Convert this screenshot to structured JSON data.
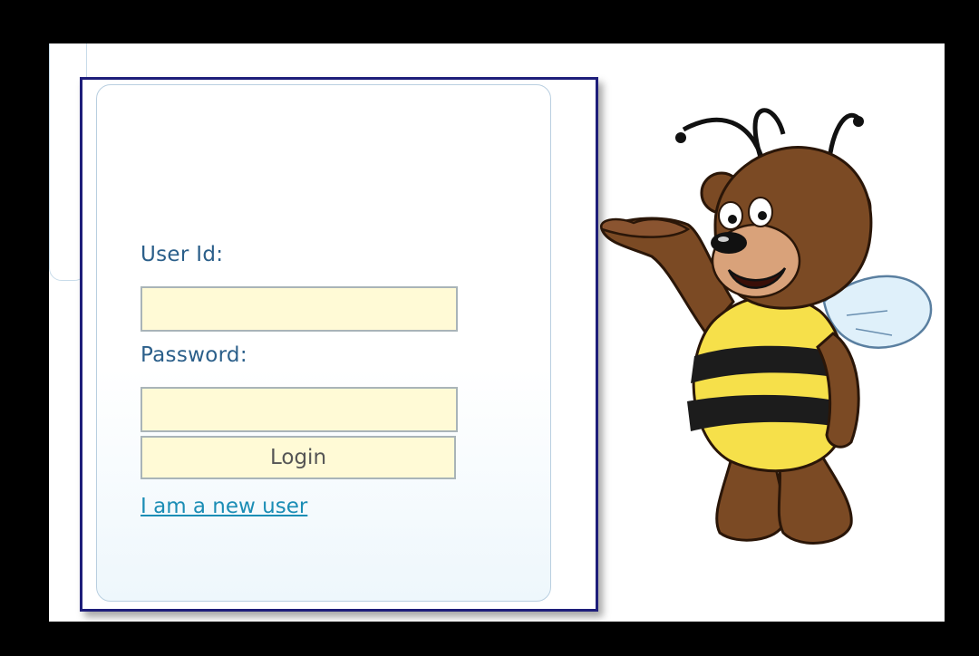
{
  "login": {
    "user_id_label": "User Id:",
    "user_id_value": "",
    "password_label": "Password:",
    "password_value": "",
    "login_button": "Login",
    "new_user_link": "I am a new user"
  },
  "mascot": {
    "icon": "bear-bee-mascot-icon"
  },
  "colors": {
    "frame_border": "#1e1e7a",
    "input_background": "#fffad6",
    "label_text": "#2b5f8a",
    "link_text": "#1b8db5"
  }
}
